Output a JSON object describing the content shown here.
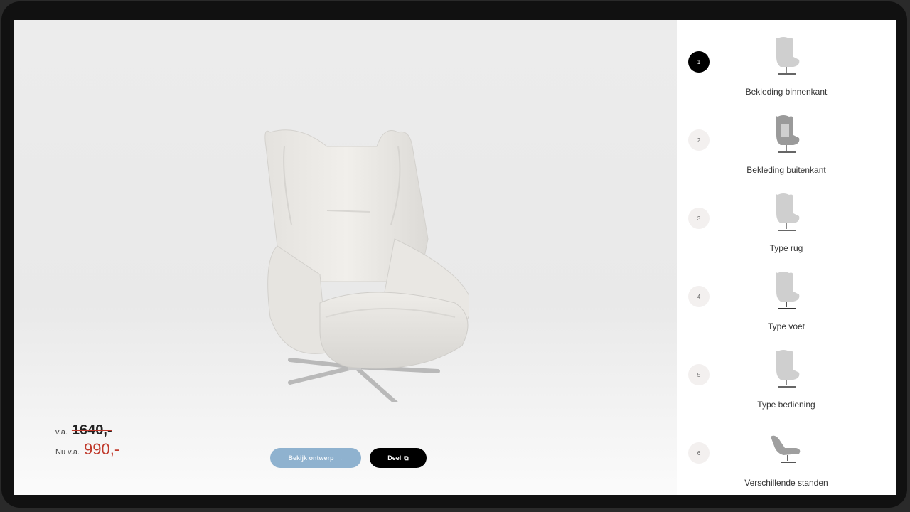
{
  "price": {
    "old_prefix": "v.a.",
    "old_price": "1640,-",
    "new_prefix": "Nu v.a.",
    "new_price": "990,-"
  },
  "buttons": {
    "view_design": "Bekijk ontwerp",
    "share": "Deel"
  },
  "steps": [
    {
      "number": "1",
      "label": "Bekleding binnenkant",
      "active": true
    },
    {
      "number": "2",
      "label": "Bekleding buitenkant",
      "active": false
    },
    {
      "number": "3",
      "label": "Type rug",
      "active": false
    },
    {
      "number": "4",
      "label": "Type voet",
      "active": false
    },
    {
      "number": "5",
      "label": "Type bediening",
      "active": false
    },
    {
      "number": "6",
      "label": "Verschillende standen",
      "active": false
    }
  ],
  "colors": {
    "accent_red": "#c0392b",
    "view_button": "#8fb2cf",
    "share_button": "#000000",
    "active_step": "#000000"
  }
}
